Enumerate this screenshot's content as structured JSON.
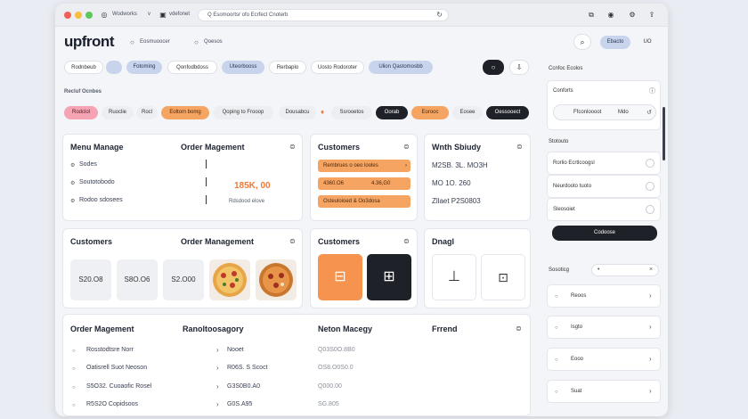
{
  "browser": {
    "tab1": "Wodworks",
    "tab1_suffix": "v",
    "tab2": "vdefonet",
    "url": "Q Esomoortsr ofo  Ecrfect  Cnoterb"
  },
  "header": {
    "logo": "upfront",
    "nav1": "Eosmuoocer",
    "nav2": "Qoesos",
    "badge": "Ebacto",
    "user": "UO"
  },
  "filters": [
    "Rodnbeub",
    "",
    "Fotoming",
    "Qonfodbdoss",
    "Uteorbooss",
    "Rerbaplo",
    "Uosto Rodoroter",
    "Ulion Qastomosbb"
  ],
  "section_label": "Recluf Ocnbes",
  "chips": [
    "Rodclol",
    "Ruoclie",
    "Rocl",
    "Eoltom bomg",
    "Qoping to Frooop",
    "Dousabcu",
    "Ssrooetos",
    "Oorab",
    "Eorooc",
    "Eosee",
    "Oessooect"
  ],
  "card_menu": {
    "title": "Menu Manage",
    "col2": "Order Magement",
    "items": [
      "Sodes",
      "Soutotobodo",
      "Rodoo sdosees"
    ],
    "amount": "185K, 00",
    "note": "Rdsdood elove"
  },
  "card_customers1": {
    "title": "Customers",
    "rows": [
      {
        "left": "Rembrues o oeo looles",
        "right": ""
      },
      {
        "left": "4360.O6",
        "right": "4.36,G0"
      },
      {
        "left": "Osteuloioed & Oo3dosa",
        "right": ""
      }
    ]
  },
  "card_status": {
    "title": "Wnth Sbiudy",
    "rows": [
      "M2SB. 3L. MO3H",
      "MO   1O. 260",
      "Zllaet    P2S0803"
    ]
  },
  "card_customers2": {
    "title": "Customers",
    "col2": "Order Management",
    "tiles": [
      "S20.O8",
      "S8O.O6",
      "S2.O00"
    ]
  },
  "card_customers3": {
    "title": "Customers"
  },
  "card_drag": {
    "title": "Dnagl"
  },
  "table": {
    "col1": "Order Magement",
    "col2": "Ranoltoosagory",
    "col3": "Neton Macegy",
    "col4": "Frrend",
    "rows": [
      {
        "name": "Rosstodtsre Norr",
        "cat": "Nooet",
        "c3": "Q03S0O.8B0"
      },
      {
        "name": "Oatisrell Suot Neoson",
        "cat": "R06S. S Scoct",
        "c3": "OS8.O0S0.0"
      },
      {
        "name": "S5O32. Cuoaofic Rosel",
        "cat": "G3S0B0.A0",
        "c3": "Q000.00"
      },
      {
        "name": "R5S2O Copidsoos",
        "cat": "G0S.A95",
        "c3": "SG.805"
      }
    ]
  },
  "sidebar": {
    "label1": "Ccnfoc Ecolos",
    "box1_title": "Conforts",
    "box1_input": "Ffconloooot",
    "box1_input2": "Mdo",
    "label2": "Stotouto",
    "options": [
      "Rorlio Ecrtlcoogsl",
      "Neurdooto tuoto",
      "Sleosoiet"
    ],
    "action": "Codoose",
    "label3": "Sosoticg",
    "items": [
      "Reoos",
      "Isgto",
      "Eooo",
      "Suat"
    ]
  }
}
